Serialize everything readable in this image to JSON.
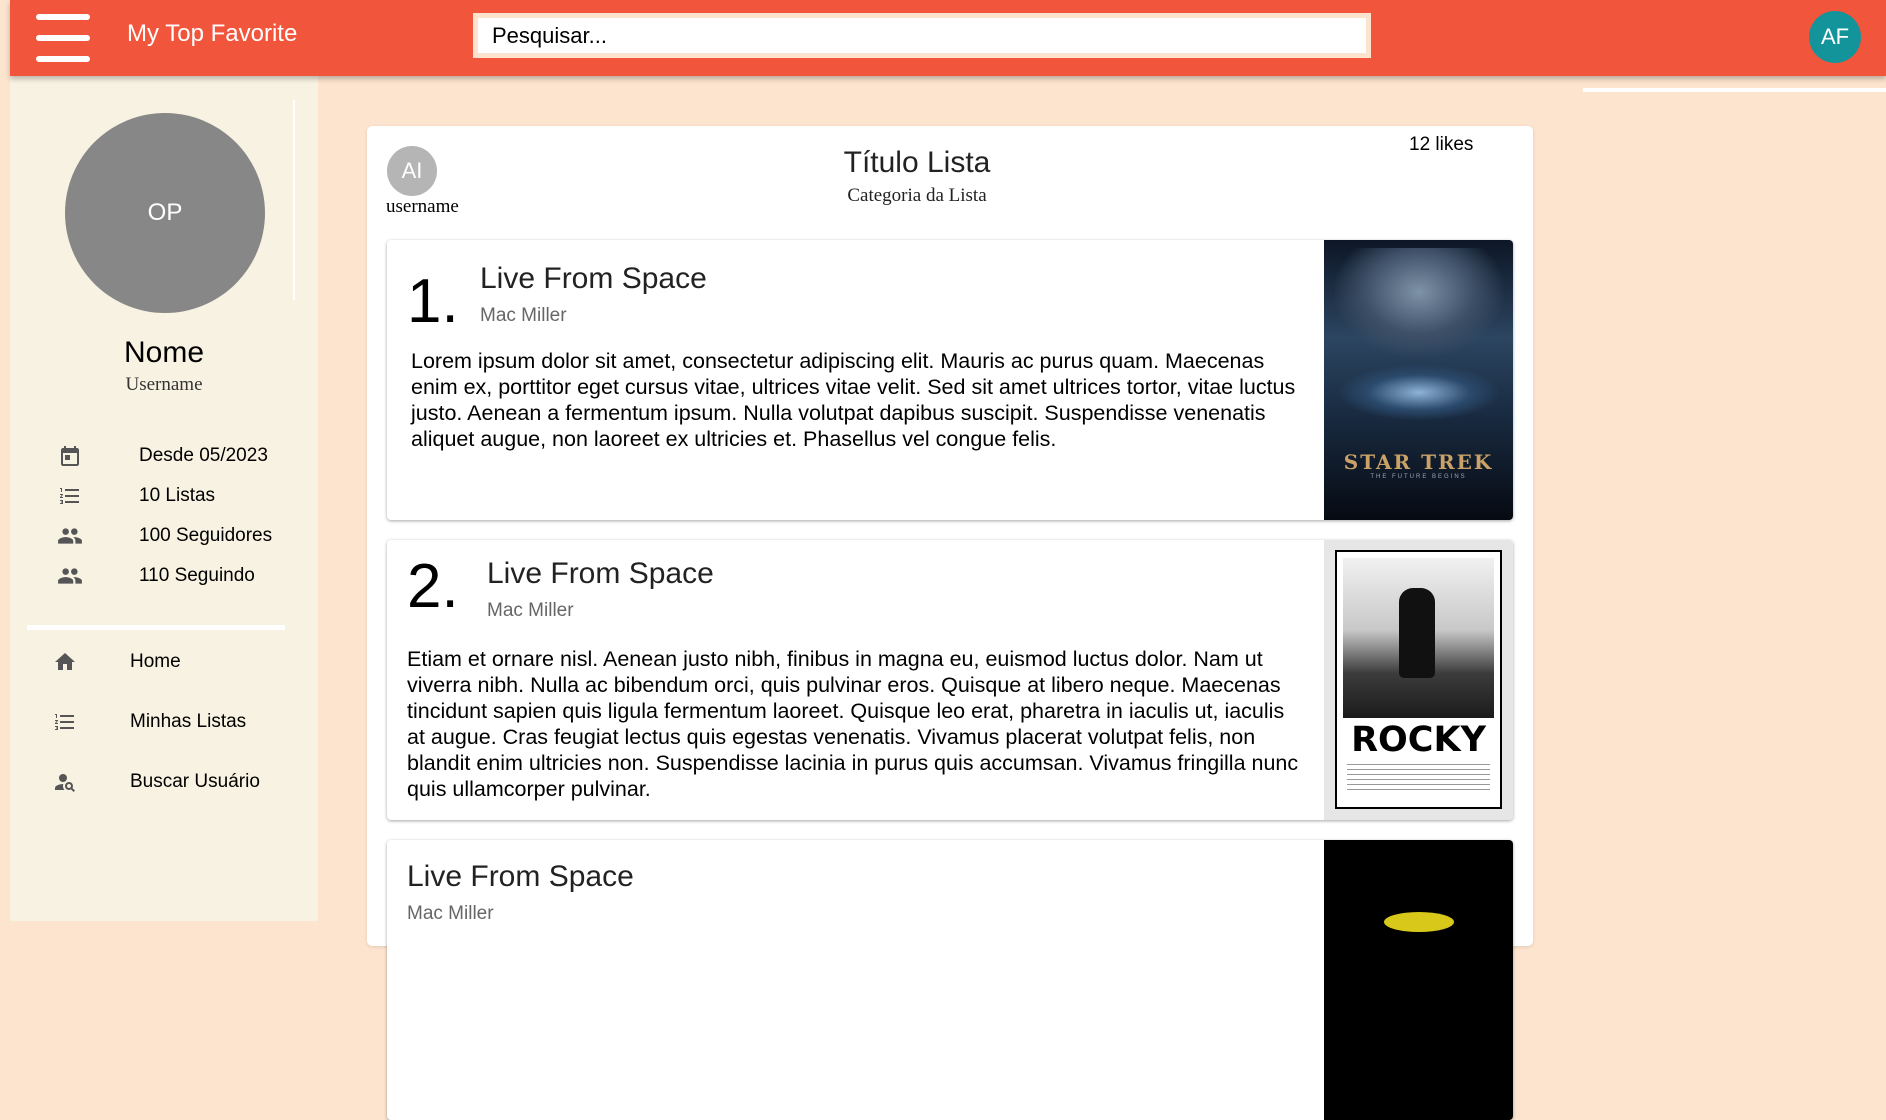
{
  "app": {
    "title": "My Top Favorite"
  },
  "header": {
    "search_placeholder": "Pesquisar...",
    "user_initials": "AF",
    "accent_color": "#f1553c",
    "avatar_color": "#13949b"
  },
  "sidebar": {
    "avatar_initials": "OP",
    "name": "Nome",
    "username": "Username",
    "stats": [
      {
        "icon": "calendar-icon",
        "label": "Desde 05/2023"
      },
      {
        "icon": "list-icon",
        "label": "10 Listas"
      },
      {
        "icon": "people-icon",
        "label": "100 Seguidores"
      },
      {
        "icon": "people-icon",
        "label": "110 Seguindo"
      }
    ],
    "nav": [
      {
        "icon": "home-icon",
        "label": "Home"
      },
      {
        "icon": "list-icon",
        "label": "Minhas Listas"
      },
      {
        "icon": "person-search-icon",
        "label": "Buscar Usuário"
      }
    ]
  },
  "list": {
    "owner_initials": "AI",
    "owner_username": "username",
    "title": "Título Lista",
    "category": "Categoria da Lista",
    "likes": "12 likes",
    "items": [
      {
        "number": "1.",
        "title": "Live From Space",
        "artist": "Mac Miller",
        "description": "Lorem ipsum dolor sit amet, consectetur adipiscing elit. Mauris ac purus quam. Maecenas enim ex, porttitor eget cursus vitae, ultrices vitae velit. Sed sit amet ultrices tortor, vitae luctus justo. Aenean a fermentum ipsum. Nulla volutpat dapibus suscipit. Suspendisse venenatis aliquet augue, non laoreet ex ultricies et. Phasellus vel congue felis.",
        "poster_title": "STAR TREK",
        "poster_subtitle": "THE FUTURE BEGINS"
      },
      {
        "number": "2.",
        "title": "Live From Space",
        "artist": "Mac Miller",
        "description": "Etiam et ornare nisl. Aenean justo nibh, finibus in magna eu, euismod luctus dolor. Nam ut viverra nibh. Nulla ac bibendum orci, quis pulvinar eros. Quisque at libero neque. Maecenas tincidunt sapien quis ligula fermentum laoreet. Quisque leo erat, pharetra in iaculis ut, iaculis at augue. Cras feugiat lectus quis egestas venenatis. Vivamus placerat volutpat felis, non blandit enim ultricies non. Suspendisse lacinia in purus quis accumsan. Vivamus fringilla nunc quis ullamcorper pulvinar.",
        "poster_title": "ROCKY"
      },
      {
        "title": "Live From Space",
        "artist": "Mac Miller"
      }
    ]
  }
}
